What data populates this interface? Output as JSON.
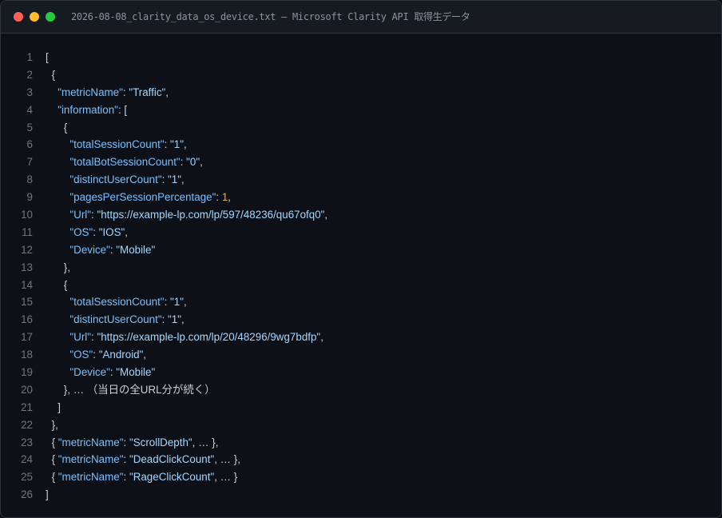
{
  "window": {
    "title": "2026-08-08_clarity_data_os_device.txt — Microsoft Clarity API 取得生データ",
    "controls": {
      "close_color": "#ff5f57",
      "minimize_color": "#febc2e",
      "maximize_color": "#28c840"
    }
  },
  "colors": {
    "key": "#79c0ff",
    "string": "#a5d6ff",
    "number": "#e3b341",
    "punctuation": "#c9d1d9",
    "line_number": "#6e7681"
  },
  "lines": [
    {
      "n": "1",
      "indent": 0,
      "tokens": [
        {
          "t": "p",
          "v": "["
        }
      ]
    },
    {
      "n": "2",
      "indent": 1,
      "tokens": [
        {
          "t": "p",
          "v": "{"
        }
      ]
    },
    {
      "n": "3",
      "indent": 2,
      "tokens": [
        {
          "t": "k",
          "v": "\"metricName\""
        },
        {
          "t": "p",
          "v": ": "
        },
        {
          "t": "s",
          "v": "\"Traffic\""
        },
        {
          "t": "p",
          "v": ","
        }
      ]
    },
    {
      "n": "4",
      "indent": 2,
      "tokens": [
        {
          "t": "k",
          "v": "\"information\""
        },
        {
          "t": "p",
          "v": ": ["
        }
      ]
    },
    {
      "n": "5",
      "indent": 3,
      "tokens": [
        {
          "t": "p",
          "v": "{"
        }
      ]
    },
    {
      "n": "6",
      "indent": 4,
      "tokens": [
        {
          "t": "k",
          "v": "\"totalSessionCount\""
        },
        {
          "t": "p",
          "v": ": "
        },
        {
          "t": "s",
          "v": "\"1\""
        },
        {
          "t": "p",
          "v": ","
        }
      ]
    },
    {
      "n": "7",
      "indent": 4,
      "tokens": [
        {
          "t": "k",
          "v": "\"totalBotSessionCount\""
        },
        {
          "t": "p",
          "v": ": "
        },
        {
          "t": "s",
          "v": "\"0\""
        },
        {
          "t": "p",
          "v": ","
        }
      ]
    },
    {
      "n": "8",
      "indent": 4,
      "tokens": [
        {
          "t": "k",
          "v": "\"distinctUserCount\""
        },
        {
          "t": "p",
          "v": ": "
        },
        {
          "t": "s",
          "v": "\"1\""
        },
        {
          "t": "p",
          "v": ","
        }
      ]
    },
    {
      "n": "9",
      "indent": 4,
      "tokens": [
        {
          "t": "k",
          "v": "\"pagesPerSessionPercentage\""
        },
        {
          "t": "p",
          "v": ": "
        },
        {
          "t": "n",
          "v": "1"
        },
        {
          "t": "p",
          "v": ","
        }
      ]
    },
    {
      "n": "10",
      "indent": 4,
      "tokens": [
        {
          "t": "k",
          "v": "\"Url\""
        },
        {
          "t": "p",
          "v": ": "
        },
        {
          "t": "s",
          "v": "\"https://example-lp.com/lp/597/48236/qu67ofq0\""
        },
        {
          "t": "p",
          "v": ","
        }
      ]
    },
    {
      "n": "11",
      "indent": 4,
      "tokens": [
        {
          "t": "k",
          "v": "\"OS\""
        },
        {
          "t": "p",
          "v": ": "
        },
        {
          "t": "s",
          "v": "\"IOS\""
        },
        {
          "t": "p",
          "v": ","
        }
      ]
    },
    {
      "n": "12",
      "indent": 4,
      "tokens": [
        {
          "t": "k",
          "v": "\"Device\""
        },
        {
          "t": "p",
          "v": ": "
        },
        {
          "t": "s",
          "v": "\"Mobile\""
        }
      ]
    },
    {
      "n": "13",
      "indent": 3,
      "tokens": [
        {
          "t": "p",
          "v": "},"
        }
      ]
    },
    {
      "n": "14",
      "indent": 3,
      "tokens": [
        {
          "t": "p",
          "v": "{"
        }
      ]
    },
    {
      "n": "15",
      "indent": 4,
      "tokens": [
        {
          "t": "k",
          "v": "\"totalSessionCount\""
        },
        {
          "t": "p",
          "v": ": "
        },
        {
          "t": "s",
          "v": "\"1\""
        },
        {
          "t": "p",
          "v": ","
        }
      ]
    },
    {
      "n": "16",
      "indent": 4,
      "tokens": [
        {
          "t": "k",
          "v": "\"distinctUserCount\""
        },
        {
          "t": "p",
          "v": ": "
        },
        {
          "t": "s",
          "v": "\"1\""
        },
        {
          "t": "p",
          "v": ","
        }
      ]
    },
    {
      "n": "17",
      "indent": 4,
      "tokens": [
        {
          "t": "k",
          "v": "\"Url\""
        },
        {
          "t": "p",
          "v": ": "
        },
        {
          "t": "s",
          "v": "\"https://example-lp.com/lp/20/48296/9wg7bdfp\""
        },
        {
          "t": "p",
          "v": ","
        }
      ]
    },
    {
      "n": "18",
      "indent": 4,
      "tokens": [
        {
          "t": "k",
          "v": "\"OS\""
        },
        {
          "t": "p",
          "v": ": "
        },
        {
          "t": "s",
          "v": "\"Android\""
        },
        {
          "t": "p",
          "v": ","
        }
      ]
    },
    {
      "n": "19",
      "indent": 4,
      "tokens": [
        {
          "t": "k",
          "v": "\"Device\""
        },
        {
          "t": "p",
          "v": ": "
        },
        {
          "t": "s",
          "v": "\"Mobile\""
        }
      ]
    },
    {
      "n": "20",
      "indent": 3,
      "tokens": [
        {
          "t": "p",
          "v": "}, … （当日の全URL分が続く）"
        }
      ]
    },
    {
      "n": "21",
      "indent": 2,
      "tokens": [
        {
          "t": "p",
          "v": "]"
        }
      ]
    },
    {
      "n": "22",
      "indent": 1,
      "tokens": [
        {
          "t": "p",
          "v": "},"
        }
      ]
    },
    {
      "n": "23",
      "indent": 1,
      "tokens": [
        {
          "t": "p",
          "v": "{ "
        },
        {
          "t": "k",
          "v": "\"metricName\""
        },
        {
          "t": "p",
          "v": ": "
        },
        {
          "t": "s",
          "v": "\"ScrollDepth\""
        },
        {
          "t": "p",
          "v": ", … },"
        }
      ]
    },
    {
      "n": "24",
      "indent": 1,
      "tokens": [
        {
          "t": "p",
          "v": "{ "
        },
        {
          "t": "k",
          "v": "\"metricName\""
        },
        {
          "t": "p",
          "v": ": "
        },
        {
          "t": "s",
          "v": "\"DeadClickCount\""
        },
        {
          "t": "p",
          "v": ", … },"
        }
      ]
    },
    {
      "n": "25",
      "indent": 1,
      "tokens": [
        {
          "t": "p",
          "v": "{ "
        },
        {
          "t": "k",
          "v": "\"metricName\""
        },
        {
          "t": "p",
          "v": ": "
        },
        {
          "t": "s",
          "v": "\"RageClickCount\""
        },
        {
          "t": "p",
          "v": ", … }"
        }
      ]
    },
    {
      "n": "26",
      "indent": 0,
      "tokens": [
        {
          "t": "p",
          "v": "]"
        }
      ]
    }
  ]
}
